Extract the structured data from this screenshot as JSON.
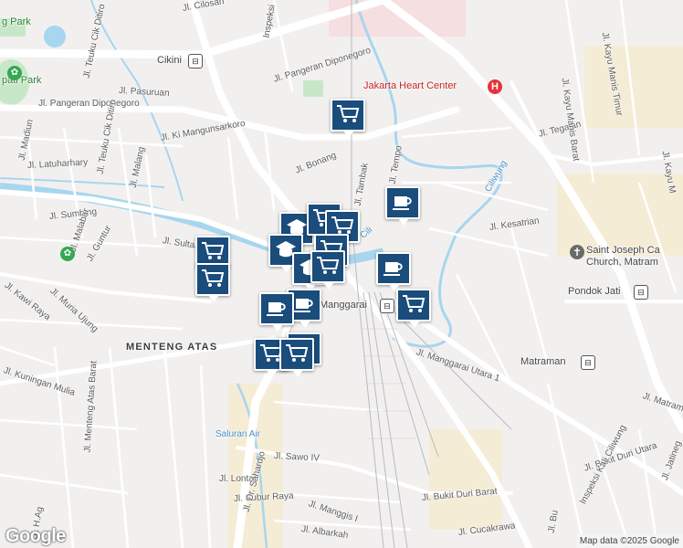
{
  "map": {
    "attribution": "Map data ©2025 Google",
    "logo": "Google",
    "streets": [
      {
        "id": "cilosari",
        "text": "Jl. Cilosari"
      },
      {
        "id": "cikditiro",
        "text": "Jl. Teuku Cik Ditiro"
      },
      {
        "id": "pasuruan",
        "text": "Jl. Pasuruan"
      },
      {
        "id": "diponegoro",
        "text": "Jl. Pangeran Diponegoro"
      },
      {
        "id": "diponegoro2",
        "text": "Jl. Pangeran Diponegoro"
      },
      {
        "id": "kimangun",
        "text": "Jl. Ki Mangunsarkoro"
      },
      {
        "id": "madiun",
        "text": "Jl. Madiun"
      },
      {
        "id": "cikditiro2",
        "text": "Jl. Teuku Cik Ditiro"
      },
      {
        "id": "malang",
        "text": "Jl. Malang"
      },
      {
        "id": "latuharhary",
        "text": "Jl. Latuharhary"
      },
      {
        "id": "bonang",
        "text": "Jl. Bonang"
      },
      {
        "id": "sumbing",
        "text": "Jl. Sumbing"
      },
      {
        "id": "malabar",
        "text": "Jl. Malabar"
      },
      {
        "id": "guntur",
        "text": "Jl. Guntur"
      },
      {
        "id": "sultanagung",
        "text": "Jl. Sultan Agung"
      },
      {
        "id": "kawiraya",
        "text": "Jl. Kawi Raya"
      },
      {
        "id": "muriaujung",
        "text": "Jl. Muria Ujung"
      },
      {
        "id": "kuningan",
        "text": "Jl. Kuningan Mulia"
      },
      {
        "id": "mentengatasbarat",
        "text": "Jl. Menteng Atas Barat"
      },
      {
        "id": "sawo",
        "text": "Jl. Sawo IV"
      },
      {
        "id": "lontar",
        "text": "Jl. Lontar"
      },
      {
        "id": "subur",
        "text": "Jl. Subur Raya"
      },
      {
        "id": "sahardjo",
        "text": "Jl. Dr. Sahardjo"
      },
      {
        "id": "manggis",
        "text": "Jl. Manggis I"
      },
      {
        "id": "albarkah",
        "text": "Jl. Albarkah"
      },
      {
        "id": "hagus",
        "text": "Jl. H.Ag"
      },
      {
        "id": "bukitduri",
        "text": "Jl. Bukit Duri Barat"
      },
      {
        "id": "cucakrawa",
        "text": "Jl. Cucakrawa"
      },
      {
        "id": "manggaraiutara",
        "text": "Jl. Manggarai Utara 1"
      },
      {
        "id": "kesatrian",
        "text": "Jl. Kesatrian"
      },
      {
        "id": "tegalan",
        "text": "Jl. Tegalan"
      },
      {
        "id": "kayumanisbarat",
        "text": "Jl. Kayu Manis Barat"
      },
      {
        "id": "kayumanistimur",
        "text": "Jl. Kayu Manis Timur"
      },
      {
        "id": "kayuma",
        "text": "Jl. Kayu M"
      },
      {
        "id": "matraman",
        "text": "Jl. Matram"
      },
      {
        "id": "bukitduriutara",
        "text": "Jl. Bukit Duri Utara"
      },
      {
        "id": "inspeksi",
        "text": "Inspeksi Kali Ciliwung"
      },
      {
        "id": "jatineg",
        "text": "Jl. Jatineg"
      },
      {
        "id": "tambak",
        "text": "Jl. Tambak"
      },
      {
        "id": "tempo",
        "text": "Jl. Tempo"
      },
      {
        "id": "inspeksi2",
        "text": "Inspeksi"
      },
      {
        "id": "bu",
        "text": "Jl. Bu"
      }
    ],
    "areas": [
      {
        "id": "mentengatas",
        "text": "MENTENG ATAS"
      }
    ],
    "water": [
      {
        "id": "ciliwung",
        "text": "Ciliwung"
      },
      {
        "id": "ciliwung2",
        "text": "Cili"
      },
      {
        "id": "saluran",
        "text": "Saluran Air"
      }
    ],
    "places": [
      {
        "id": "cikini",
        "text": "Cikini"
      },
      {
        "id": "manggarai",
        "text": "Manggarai"
      },
      {
        "id": "matraman-st",
        "text": "Matraman"
      },
      {
        "id": "pondokjati",
        "text": "Pondok Jati"
      },
      {
        "id": "heartcenter",
        "text": "Jakarta Heart Center"
      },
      {
        "id": "stjoseph",
        "text": "Saint Joseph Ca\nChurch, Matram"
      },
      {
        "id": "park1",
        "text": "g Park"
      },
      {
        "id": "park2",
        "text": "pati Park"
      }
    ],
    "markers": [
      {
        "icon": "shopping-cart-icon"
      },
      {
        "icon": "coffee-icon"
      },
      {
        "icon": "school-icon"
      },
      {
        "icon": "shopping-cart-icon"
      },
      {
        "icon": "school-icon"
      },
      {
        "icon": "shopping-cart-icon"
      },
      {
        "icon": "shopping-cart-icon"
      },
      {
        "icon": "school-icon"
      },
      {
        "icon": "shopping-cart-icon"
      },
      {
        "icon": "shopping-cart-icon"
      },
      {
        "icon": "coffee-icon"
      },
      {
        "icon": "coffee-icon"
      },
      {
        "icon": "shopping-cart-icon"
      },
      {
        "icon": "coffee-icon"
      },
      {
        "icon": "coffee-icon"
      },
      {
        "icon": "shopping-cart-icon"
      },
      {
        "icon": "shopping-cart-icon"
      },
      {
        "icon": "shopping-cart-icon"
      }
    ],
    "colors": {
      "background": "#f2f0ef",
      "road": "#ffffff",
      "major_road": "#ffffff",
      "water": "#a7d6ef",
      "park": "#c7e8c8",
      "marker": "#1a4c7c",
      "urban_beige": "#f5ecd5"
    }
  }
}
